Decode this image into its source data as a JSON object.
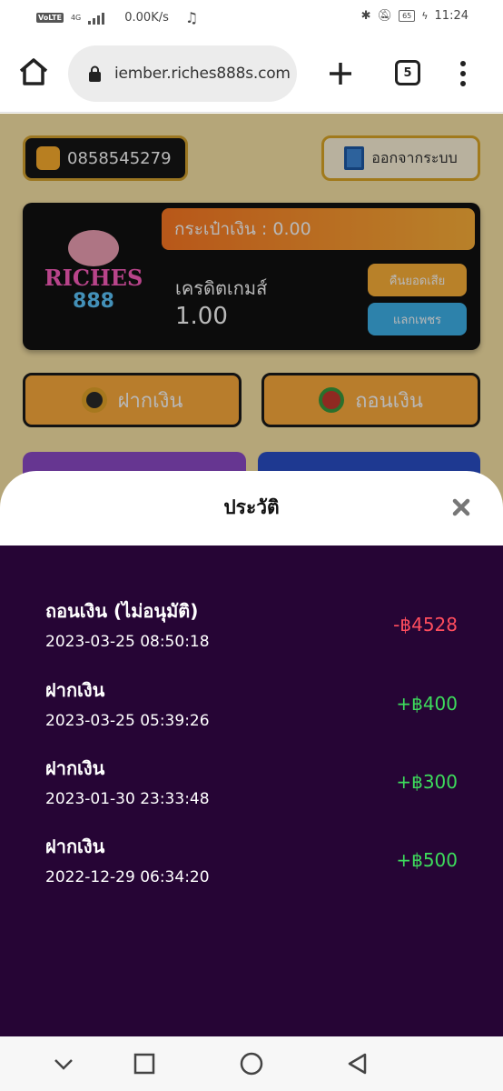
{
  "status_bar": {
    "network": "VoLTE",
    "network_type": "4G",
    "speed": "0.00K/s",
    "battery": "65",
    "time": "11:24"
  },
  "browser": {
    "url": "iember.riches888s.com",
    "tab_count": "5"
  },
  "account": {
    "phone": "0858545279",
    "logout_label": "ออกจากระบบ"
  },
  "wallet": {
    "logo_line1": "RICHES",
    "logo_line2": "888",
    "wallet_label": "กระเป๋าเงิน : 0.00",
    "credit_label": "เครดิตเกมส์",
    "credit_value": "1.00",
    "cashback_label": "คืนยอดเสีย",
    "exchange_label": "แลกเพชร"
  },
  "actions": {
    "deposit_label": "ฝากเงิน",
    "withdraw_label": "ถอนเงิน"
  },
  "modal": {
    "title": "ประวัติ",
    "transactions": [
      {
        "type": "ถอนเงิน (ไม่อนุมัติ)",
        "date": "2023-03-25 08:50:18",
        "amount": "-฿4528",
        "color": "#ff4d5e"
      },
      {
        "type": "ฝากเงิน",
        "date": "2023-03-25 05:39:26",
        "amount": "+฿400",
        "color": "#3ddc5c"
      },
      {
        "type": "ฝากเงิน",
        "date": "2023-01-30 23:33:48",
        "amount": "+฿300",
        "color": "#3ddc5c"
      },
      {
        "type": "ฝากเงิน",
        "date": "2022-12-29 06:34:20",
        "amount": "+฿500",
        "color": "#3ddc5c"
      }
    ]
  },
  "colors": {
    "accent_orange": "#ffae3d",
    "modal_bg": "#260535",
    "negative": "#ff4d5e",
    "positive": "#3ddc5c"
  }
}
